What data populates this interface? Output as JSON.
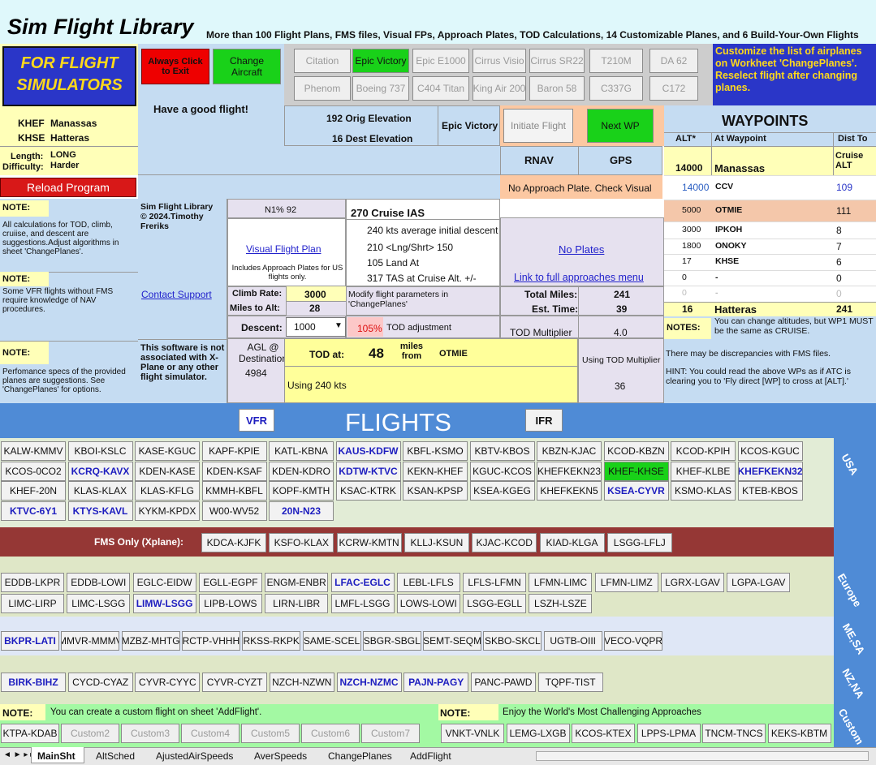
{
  "title": "Sim Flight Library",
  "subtitle": "More than 100 Flight Plans, FMS files, Visual FPs, Approach Plates, TOD Calculations, 14 Customizable Planes, and 6 Build-Your-Own Flights",
  "logo": [
    "FOR FLIGHT",
    "SIMULATORS"
  ],
  "always_click": "Always Click to Exit",
  "change_aircraft": "Change Aircraft",
  "good_flight": "Have a good flight!",
  "planes": [
    [
      "Citation",
      "Epic Victory",
      "Epic E1000",
      "Cirrus Visio",
      "Cirrus SR22",
      "T210M",
      "DA 62"
    ],
    [
      "Phenom",
      "Boeing 737",
      "C404 Titan",
      "King Air 200",
      "Baron 58",
      "C337G",
      "C172"
    ]
  ],
  "customize_note": "Customize the  list of airplanes on Workheet 'ChangePlanes'. Reselect flight after changing planes.",
  "orig": {
    "code": "KHEF",
    "name": "Manassas"
  },
  "dest": {
    "code": "KHSE",
    "name": "Hatteras"
  },
  "orig_elev": "192  Orig Elevation",
  "dest_elev": "16  Dest Elevation",
  "selected_plane": "Epic Victory",
  "initiate": "Initiate Flight",
  "next_wp": "Next WP",
  "length_label": "Length:",
  "length": "LONG",
  "difficulty_label": "Difficulty:",
  "difficulty": "Harder",
  "rnav": "RNAV",
  "gps": "GPS",
  "approach_plate": "No Approach Plate. Check Visual",
  "reload": "Reload Program",
  "waypoints_title": "WAYPOINTS",
  "wp_headers": [
    "ALT*",
    "At Waypoint",
    "Dist To"
  ],
  "cruise_alt_label": "Cruise ALT",
  "wp_start": {
    "alt": "14000",
    "name": "Manassas"
  },
  "waypoints": [
    {
      "alt": "14000",
      "name": "CCV",
      "dist": "109"
    },
    {
      "alt": "5000",
      "name": "OTMIE",
      "dist": "111"
    },
    {
      "alt": "3000",
      "name": "IPKOH",
      "dist": "8"
    },
    {
      "alt": "1800",
      "name": "ONOKY",
      "dist": "7"
    },
    {
      "alt": "17",
      "name": "KHSE",
      "dist": "6"
    },
    {
      "alt": "0",
      "name": "-",
      "dist": "0"
    },
    {
      "alt": "0",
      "name": "-",
      "dist": "0"
    }
  ],
  "wp_end": {
    "alt": "16",
    "name": "Hatteras",
    "dist": "241"
  },
  "notes_label": "NOTES:",
  "wp_note": "You can change altitudes, but WP1 MUST be the same as CRUISE.",
  "fms_note": "There may be discrepancies with FMS files.",
  "hint": "HINT: You could read the above WPs as if ATC is clearing you to 'Fly direct [WP] to cross at [ALT].'",
  "note_label": "NOTE:",
  "note1": "All calculations for TOD, climb, cruiise, and descent are suggestions.Adjust algorithms in sheet 'ChangePlanes'.",
  "note2": "Some VFR flights without FMS require knowledge of NAV procedures.",
  "note3": "Perfomance specs of the provided planes are suggestions. See 'ChangePlanes' for options.",
  "copyright": "Sim Flight Library © 2024.Timothy Freriks",
  "contact": "Contact Support",
  "disclaimer": "This software is not associated with X-Plane or any other flight simulator.",
  "n1": "N1%  92",
  "visual_fp": "Visual Flight Plan",
  "includes_plates": "Includes Approach Plates for US flights only.",
  "cruise_ias": "270  Cruise IAS",
  "descent_lines": [
    "240  kts average initial descent",
    "210  <Lng/Shrt>  150",
    "105  Land At",
    "317  TAS at Cruise Alt. +/-"
  ],
  "no_plates": "No Plates",
  "full_approaches": "Link to full approaches menu",
  "climb_rate_label": "Climb Rate:",
  "climb_rate": "3000",
  "miles_alt_label": "Miles to Alt:",
  "miles_alt": "28",
  "modify": "Modify flight parameters in 'ChangePlanes'",
  "total_miles_label": "Total Miles:",
  "total_miles": "241",
  "est_time_label": "Est. Time:",
  "est_time": "39",
  "descent_label": "Descent:",
  "descent": "1000",
  "tod_pct": "105%",
  "tod_adj": "TOD adjustment",
  "tod_mult_label": "TOD Multiplier",
  "tod_mult": "4.0",
  "agl_label": "AGL @ Destination",
  "agl": "4984",
  "tod_at": "TOD at:",
  "tod_miles": "48",
  "miles_from": "miles from",
  "tod_wp": "OTMIE",
  "using_kts": "Using 240 kts",
  "using_tod": "Using TOD Multiplier",
  "using_tod_val": "36",
  "vfr": "VFR",
  "ifr": "IFR",
  "flights_title": "FLIGHTS",
  "usa": [
    [
      "KALW-KMMV",
      "KBOI-KSLC",
      "KASE-KGUC",
      "KAPF-KPIE",
      "KATL-KBNA",
      "KAUS-KDFW",
      "KBFL-KSMO",
      "KBTV-KBOS",
      "KBZN-KJAC",
      "KCOD-KBZN",
      "KCOD-KPIH",
      "KCOS-KGUC"
    ],
    [
      "KCOS-0CO2",
      "KCRQ-KAVX",
      "KDEN-KASE",
      "KDEN-KSAF",
      "KDEN-KDRO",
      "KDTW-KTVC",
      "KEKN-KHEF",
      "KGUC-KCOS",
      "KHEFKEKN23",
      "KHEF-KHSE",
      "KHEF-KLBE",
      "KHEFKEKN32"
    ],
    [
      "KHEF-20N",
      "KLAS-KLAX",
      "KLAS-KFLG",
      "KMMH-KBFL",
      "KOPF-KMTH",
      "KSAC-KTRK",
      "KSAN-KPSP",
      "KSEA-KGEG",
      "KHEFKEKN5",
      "KSEA-CYVR",
      "KSMO-KLAS",
      "KTEB-KBOS"
    ],
    [
      "KTVC-6Y1",
      "KTYS-KAVL",
      "KYKM-KPDX",
      "W00-WV52",
      "20N-N23"
    ]
  ],
  "usa_label": "USA",
  "fms_only": "FMS Only (Xplane):",
  "fms_flights": [
    "KDCA-KJFK",
    "KSFO-KLAX",
    "KCRW-KMTN",
    "KLLJ-KSUN",
    "KJAC-KCOD",
    "KIAD-KLGA",
    "LSGG-LFLJ"
  ],
  "europe": [
    [
      "EDDB-LKPR",
      "EDDB-LOWI",
      "EGLC-EIDW",
      "EGLL-EGPF",
      "ENGM-ENBR",
      "LFAC-EGLC",
      "LEBL-LFLS",
      "LFLS-LFMN",
      "LFMN-LIMC",
      "LFMN-LIMZ",
      "LGRX-LGAV",
      "LGPA-LGAV"
    ],
    [
      "LIMC-LIRP",
      "LIMC-LSGG",
      "LIMW-LSGG",
      "LIPB-LOWS",
      "LIRN-LIBR",
      "LMFL-LSGG",
      "LOWS-LOWI",
      "LSGG-EGLL",
      "LSZH-LSZE"
    ]
  ],
  "europe_label": "Europe",
  "mesa": [
    "BKPR-LATI",
    "MMVR-MMMV",
    "MZBZ-MHTG",
    "RCTP-VHHH",
    "RKSS-RKPK",
    "SAME-SCEL",
    "SBGR-SBGL",
    "SEMT-SEQM",
    "SKBO-SKCL",
    "UGTB-OIII",
    "VECO-VQPR"
  ],
  "mesa_label": "ME,SA",
  "nzna": [
    "BIRK-BIHZ",
    "CYCD-CYAZ",
    "CYVR-CYYC",
    "CYVR-CYZT",
    "NZCH-NZWN",
    "NZCH-NZMC",
    "PAJN-PAGY",
    "PANC-PAWD",
    "TQPF-TIST"
  ],
  "nzna_label": "NZ,NA",
  "custom_note": "You can create a custom flight on sheet 'AddFlight'.",
  "challenge_note": "Enjoy the World's Most Challenging Approaches",
  "custom": [
    "KTPA-KDAB",
    "Custom2",
    "Custom3",
    "Custom4",
    "Custom5",
    "Custom6",
    "Custom7"
  ],
  "challenge": [
    "VNKT-VNLK",
    "LEMG-LXGB",
    "KCOS-KTEX",
    "LPPS-LPMA",
    "TNCM-TNCS",
    "KEKS-KBTM"
  ],
  "custom_label": "Custom",
  "tabs": [
    "MainSht",
    "AltSched",
    "AjustedAirSpeeds",
    "AverSpeeds",
    "ChangePlanes",
    "AddFlight"
  ],
  "colors": {
    "sky": "#c5dcf2",
    "yellow": "#ffffb8",
    "orange": "#fcc8a2",
    "green": "#19d119",
    "red": "#e00000",
    "blue": "#2a36c8",
    "maroon": "#953735",
    "olive": "#dfe7c7",
    "lilac": "#e6e1ef",
    "flightsBlue": "#4f8bd6",
    "pinkwp": "#f4c7aa",
    "lightgreen": "#a3f9a3"
  }
}
